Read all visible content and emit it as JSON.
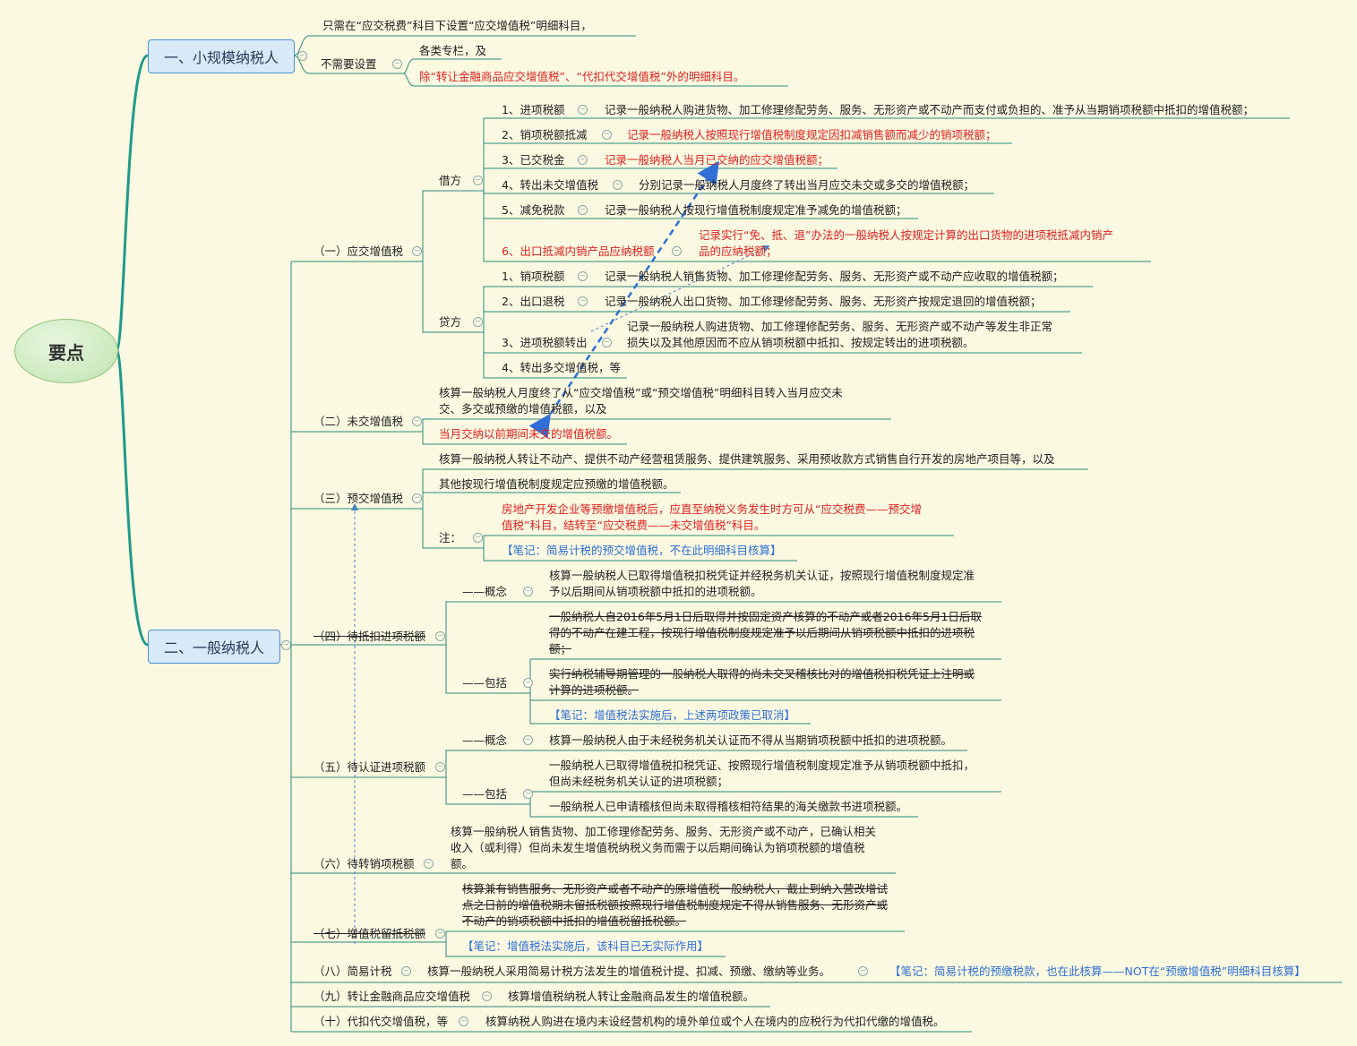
{
  "root": "要点",
  "level1": [
    {
      "label": "一、小规模纳税人"
    },
    {
      "label": "二、一般纳税人"
    }
  ],
  "small": {
    "setup": "只需在“应交税费”科目下设置“应交增值税”明细科目，",
    "no_need": "不需要设置",
    "no_need_items": [
      "各类专栏，及",
      "除“转让金融商品应交增值税”、“代扣代交增值税”外的明细科目。"
    ]
  },
  "general": [
    {
      "label": "（一）应交增值税"
    },
    {
      "label": "（二）未交增值税"
    },
    {
      "label": "（三）预交增值税"
    },
    {
      "label": "（四）待抵扣进项税额"
    },
    {
      "label": "（五）待认证进项税额"
    },
    {
      "label": "（六）待转销项税额"
    },
    {
      "label": "（七）增值税留抵税额"
    },
    {
      "label": "（八）简易计税"
    },
    {
      "label": "（九）转让金融商品应交增值税"
    },
    {
      "label": "（十）代扣代交增值税，等"
    }
  ],
  "debit": {
    "label": "借方",
    "items": [
      {
        "name": "1、进项税额",
        "desc": "记录一般纳税人购进货物、加工修理修配劳务、服务、无形资产或不动产而支付或负担的、准予从当期销项税额中抵扣的增值税额；"
      },
      {
        "name": "2、销项税额抵减",
        "desc": "记录一般纳税人按照现行增值税制度规定因扣减销售额而减少的销项税额；"
      },
      {
        "name": "3、已交税金",
        "desc": "记录一般纳税人当月已交纳的应交增值税额；"
      },
      {
        "name": "4、转出未交增值税",
        "desc": "分别记录一般纳税人月度终了转出当月应交未交或多交的增值税额；"
      },
      {
        "name": "5、减免税款",
        "desc": "记录一般纳税人按现行增值税制度规定准予减免的增值税额；"
      },
      {
        "name": "6、出口抵减内销产品应纳税额",
        "desc1": "记录实行“免、抵、退”办法的一般纳税人按规定计算的出口货物的进项税抵减内销产",
        "desc2": "品的应纳税额；"
      }
    ]
  },
  "credit": {
    "label": "贷方",
    "items": [
      {
        "name": "1、销项税额",
        "desc": "记录一般纳税人销售货物、加工修理修配劳务、服务、无形资产或不动产应收取的增值税额；"
      },
      {
        "name": "2、出口退税",
        "desc": "记录一般纳税人出口货物、加工修理修配劳务、服务、无形资产按规定退回的增值税额；"
      },
      {
        "name": "3、进项税额转出",
        "desc1": "记录一般纳税人购进货物、加工修理修配劳务、服务、无形资产或不动产等发生非正常",
        "desc2": "损失以及其他原因而不应从销项税额中抵扣、按规定转出的进项税额。"
      },
      {
        "name": "4、转出多交增值税，等"
      }
    ]
  },
  "unpaid": {
    "line1": "核算一般纳税人月度终了从“应交增值税”或“预交增值税”明细科目转入当月应交未",
    "line2": "交、多交或预缴的增值税额，以及",
    "line3": "当月交纳以前期间未交的增值税额。"
  },
  "prepaid": {
    "line1": "核算一般纳税人转让不动产、提供不动产经营租赁服务、提供建筑服务、采用预收款方式销售自行开发的房地产项目等，以及",
    "line2": "其他按现行增值税制度规定应预缴的增值税额。",
    "note_label": "注：",
    "note1a": "房地产开发企业等预缴增值税后，应直至纳税义务发生时方可从“应交税费——预交增",
    "note1b": "值税”科目，结转至“应交税费——未交增值税”科目。",
    "note2": "【笔记：简易计税的预交增值税，不在此明细科目核算】"
  },
  "pending_deduct": {
    "concept_label": "——概念",
    "concept1": "核算一般纳税人已取得增值税扣税凭证并经税务机关认证，按照现行增值税制度规定准",
    "concept2": "予以后期间从销项税额中抵扣的进项税额。",
    "include_label": "——包括",
    "inc1a": "一般纳税人自2016年5月1日后取得并按固定资产核算的不动产或者2016年5月1日后取",
    "inc1b": "得的不动产在建工程，按现行增值税制度规定准予以后期间从销项税额中抵扣的进项税",
    "inc1c": "额；",
    "inc2a": "实行纳税辅导期管理的一般纳税人取得的尚未交叉稽核比对的增值税扣税凭证上注明或",
    "inc2b": "计算的进项税额。",
    "note": "【笔记：增值税法实施后，上述两项政策已取消】"
  },
  "pending_cert": {
    "concept_label": "——概念",
    "concept": "核算一般纳税人由于未经税务机关认证而不得从当期销项税额中抵扣的进项税额。",
    "include_label": "——包括",
    "inc1a": "一般纳税人已取得增值税扣税凭证、按照现行增值税制度规定准予从销项税额中抵扣，",
    "inc1b": "但尚未经税务机关认证的进项税额；",
    "inc2": "一般纳税人已申请稽核但尚未取得稽核相符结果的海关缴款书进项税额。"
  },
  "pending_output": {
    "l1": "核算一般纳税人销售货物、加工修理修配劳务、服务、无形资产或不动产，已确认相关",
    "l2": "收入（或利得）但尚未发生增值税纳税义务而需于以后期间确认为销项税额的增值税",
    "l3": "额。"
  },
  "retained": {
    "l1": "核算兼有销售服务、无形资产或者不动产的原增值税一般纳税人，截止到纳入营改增试",
    "l2": "点之日前的增值税期末留抵税额按照现行增值税制度规定不得从销售服务、无形资产或",
    "l3": "不动产的销项税额中抵扣的增值税留抵税额。",
    "note": "【笔记：增值税法实施后，该科目已无实际作用】"
  },
  "simple": {
    "desc": "核算一般纳税人采用简易计税方法发生的增值税计提、扣减、预缴、缴纳等业务。",
    "note": "【笔记：简易计税的预缴税款，也在此核算——NOT在“预缴增值税”明细科目核算】"
  },
  "financial": {
    "desc": "核算增值税纳税人转让金融商品发生的增值税额。"
  },
  "withhold": {
    "desc": "核算纳税人购进在境内未设经营机构的境外单位或个人在境内的应税行为代扣代缴的增值税。"
  },
  "colors": {
    "line": "#2a8a7a",
    "root_branch": "#1f9a8a",
    "red": "#e02020",
    "blue": "#2f6fd6"
  }
}
